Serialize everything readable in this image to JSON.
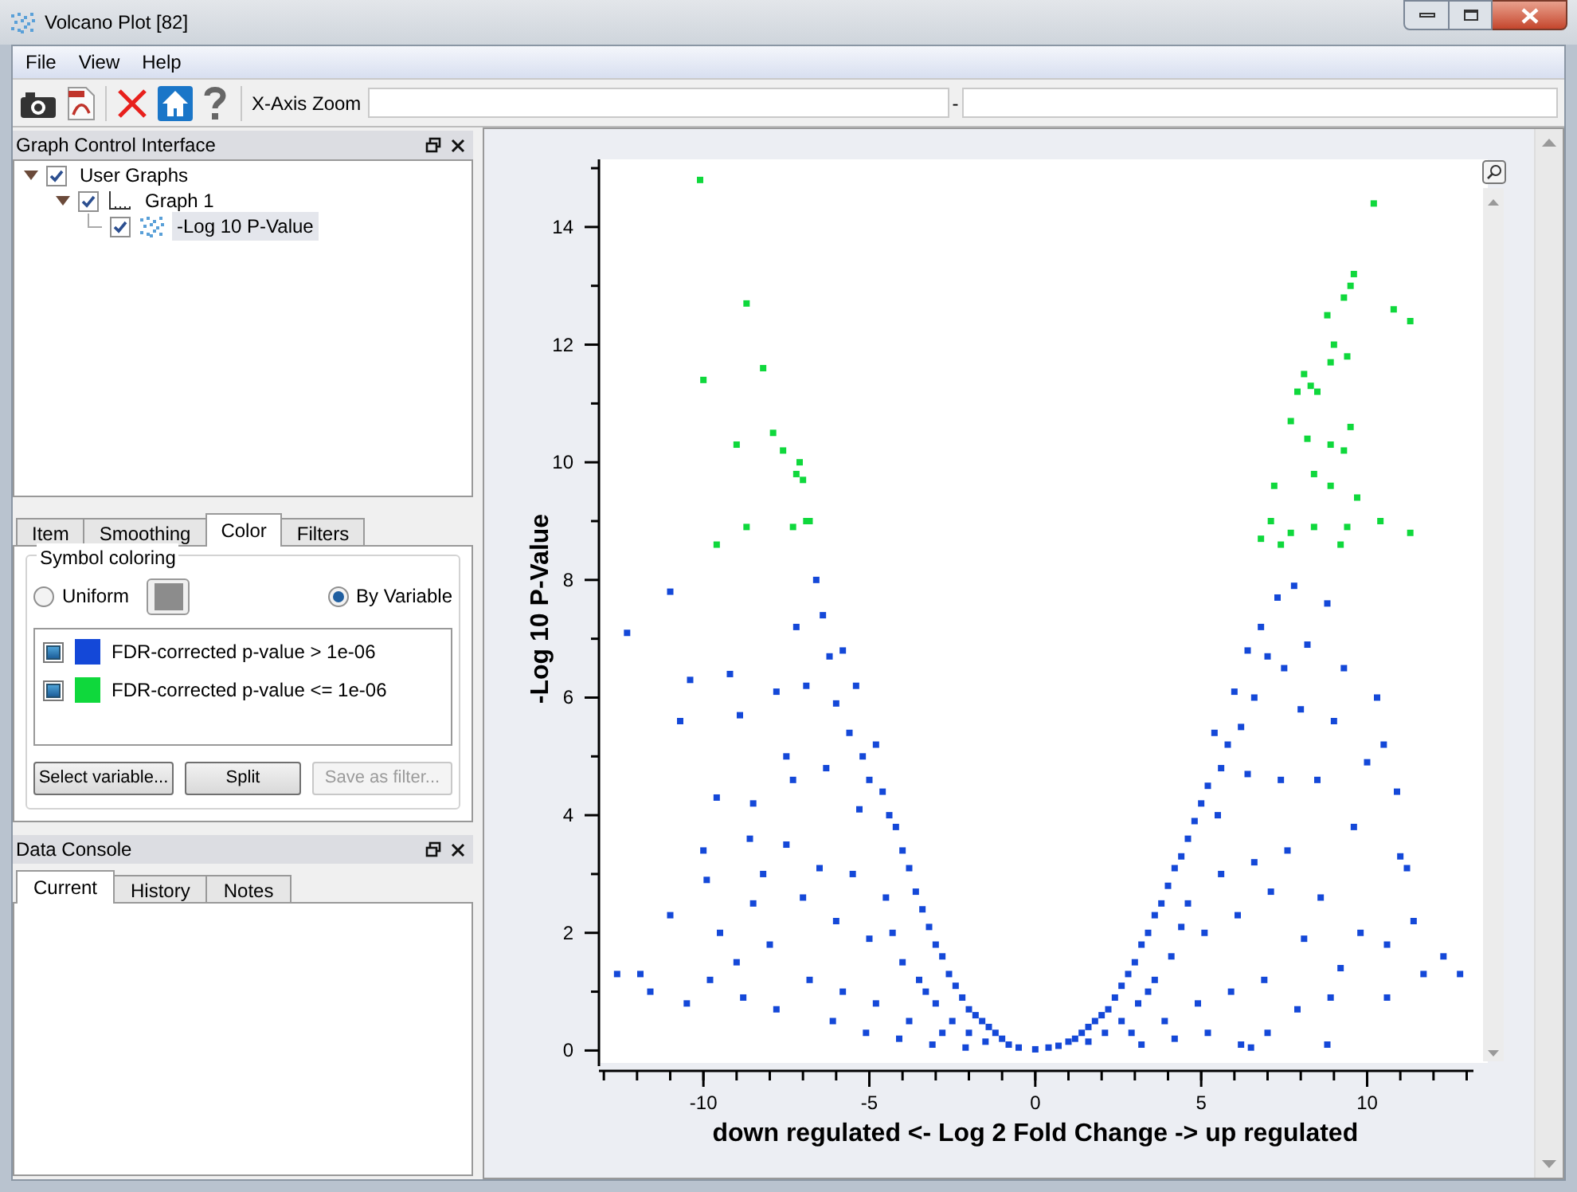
{
  "window": {
    "title": "Volcano Plot [82]"
  },
  "menu": [
    "File",
    "View",
    "Help"
  ],
  "toolbar": {
    "zoom_label": "X-Axis Zoom",
    "range_separator": "-"
  },
  "graph_control": {
    "title": "Graph Control Interface",
    "tree": [
      {
        "label": "User Graphs",
        "checked": true,
        "expanded": true,
        "children": [
          {
            "label": "Graph 1",
            "kind": "graph",
            "checked": true,
            "expanded": true,
            "children": [
              {
                "label": "-Log 10 P-Value",
                "kind": "series",
                "checked": true,
                "selected": true
              }
            ]
          }
        ]
      }
    ]
  },
  "tabs": [
    {
      "label": "Item",
      "selected": false
    },
    {
      "label": "Smoothing",
      "selected": false
    },
    {
      "label": "Color",
      "selected": true
    },
    {
      "label": "Filters",
      "selected": false
    }
  ],
  "symbol_coloring": {
    "title": "Symbol coloring",
    "options": [
      {
        "label": "Uniform",
        "selected": false
      },
      {
        "label": "By Variable",
        "selected": true
      }
    ],
    "categories": [
      {
        "label": "FDR-corrected p-value > 1e-06",
        "checked": true,
        "color": "#1448d8"
      },
      {
        "label": "FDR-corrected p-value <= 1e-06",
        "checked": true,
        "color": "#0fd83c"
      }
    ],
    "buttons": [
      {
        "label": "Select variable...",
        "disabled": false
      },
      {
        "label": "Split",
        "disabled": false
      },
      {
        "label": "Save as filter...",
        "disabled": true
      }
    ]
  },
  "data_console": {
    "title": "Data Console",
    "tabs": [
      {
        "label": "Current",
        "selected": true
      },
      {
        "label": "History",
        "selected": false
      },
      {
        "label": "Notes",
        "selected": false
      }
    ]
  },
  "chart": {
    "chart_data": {
      "type": "scatter",
      "xlabel": "down regulated <- Log 2 Fold Change -> up regulated",
      "ylabel": "-Log 10 P-Value",
      "xlim": [
        -13.1,
        13.3
      ],
      "ylim": [
        -0.13,
        15.15
      ],
      "xticks": [
        -10,
        -5,
        0,
        5,
        10
      ],
      "yticks": [
        0,
        2,
        4,
        6,
        8,
        10,
        12,
        14
      ],
      "series": [
        {
          "color": "#1448d8",
          "x": [
            -12.3,
            -11,
            -10.4,
            -10.7,
            -11.9,
            -12.6,
            -11.6,
            -11,
            -10,
            -9.6,
            -9.2,
            -8.9,
            -8.5,
            -8.2,
            -7.8,
            -7.5,
            -7.2,
            -6.9,
            -6.6,
            -6.4,
            -6.2,
            -6,
            -5.8,
            -5.6,
            -5.4,
            -5.2,
            -5,
            -4.8,
            -4.6,
            -4.4,
            -4.2,
            -4,
            -3.8,
            -3.6,
            -3.4,
            -3.2,
            -3,
            -2.8,
            -2.6,
            -2.4,
            -2.2,
            -2,
            -1.8,
            -1.6,
            -1.4,
            -1.2,
            -1,
            -0.8,
            -0.5,
            -9.5,
            -9,
            -8.5,
            -8,
            -7.5,
            -7,
            -6.5,
            -6,
            -5.5,
            -5,
            -4.5,
            -4,
            -3.5,
            -3,
            -2.5,
            -2,
            -1.5,
            -6.8,
            -5.8,
            -4.8,
            -3.8,
            -2.8,
            -8.8,
            -7.8,
            -10.5,
            -9.8,
            -7.3,
            -6.3,
            -5.3,
            -4.3,
            -3.3,
            -9.9,
            -8.6,
            -6.1,
            -5.1,
            -4.1,
            -3.1,
            -2.1,
            12.3,
            11.7,
            11.4,
            11,
            10.9,
            10.5,
            10.3,
            10,
            9.6,
            9.3,
            9,
            8.8,
            8.5,
            8.2,
            8,
            7.8,
            7.5,
            7.3,
            7,
            6.8,
            6.6,
            6.4,
            6.2,
            6,
            5.8,
            5.6,
            5.4,
            5.2,
            5,
            4.8,
            4.6,
            4.4,
            4.2,
            4,
            3.8,
            3.6,
            3.4,
            3.2,
            3,
            2.8,
            2.6,
            2.4,
            2.2,
            2,
            1.8,
            1.6,
            1.4,
            1.2,
            1,
            0.7,
            0.4,
            0,
            9.8,
            9.2,
            8.6,
            8.1,
            7.6,
            7.1,
            6.6,
            6.1,
            5.6,
            5.1,
            4.6,
            4.1,
            3.6,
            3.1,
            2.6,
            2.1,
            1.6,
            6.9,
            5.9,
            4.9,
            3.9,
            2.9,
            8.9,
            7.9,
            10.6,
            7.4,
            6.4,
            5.5,
            4.4,
            3.4,
            8.8,
            6.2,
            6.5,
            7,
            5.2,
            4.2,
            3.2,
            11.2,
            12.8,
            10.6
          ],
          "values": [
            7.1,
            7.8,
            6.3,
            5.6,
            1.3,
            1.3,
            1,
            2.3,
            3.4,
            4.3,
            6.4,
            5.7,
            4.2,
            3,
            6.1,
            5,
            7.2,
            6.2,
            8,
            7.4,
            6.7,
            5.9,
            6.8,
            5.4,
            6.2,
            5,
            4.6,
            5.2,
            4.4,
            4,
            3.8,
            3.4,
            3.1,
            2.7,
            2.4,
            2.1,
            1.8,
            1.6,
            1.3,
            1.1,
            0.9,
            0.7,
            0.6,
            0.5,
            0.4,
            0.3,
            0.2,
            0.1,
            0.05,
            2,
            1.5,
            2.5,
            1.8,
            3.5,
            2.6,
            3.1,
            2.2,
            3,
            1.9,
            2.6,
            1.5,
            1.2,
            0.8,
            0.5,
            0.3,
            0.15,
            1.2,
            1,
            0.8,
            0.5,
            0.3,
            0.9,
            0.7,
            0.8,
            1.2,
            4.6,
            4.8,
            4.1,
            2,
            1,
            2.9,
            3.6,
            0.5,
            0.3,
            0.2,
            0.1,
            0.05,
            1.6,
            1.3,
            2.2,
            3.3,
            4.4,
            5.2,
            6,
            4.9,
            3.8,
            6.5,
            5.6,
            7.6,
            4.6,
            6.9,
            5.8,
            7.9,
            6.5,
            7.7,
            6.7,
            7.2,
            6,
            6.8,
            5.5,
            6.1,
            5.2,
            4.8,
            5.4,
            4.5,
            4.2,
            3.9,
            3.6,
            3.3,
            3.1,
            2.8,
            2.5,
            2.3,
            2,
            1.8,
            1.5,
            1.3,
            1.1,
            0.9,
            0.7,
            0.6,
            0.5,
            0.4,
            0.3,
            0.2,
            0.15,
            0.08,
            0.05,
            0.02,
            2,
            1.4,
            2.6,
            1.9,
            3.4,
            2.7,
            3.2,
            2.3,
            3,
            2,
            2.5,
            1.6,
            1.2,
            0.8,
            0.5,
            0.3,
            0.15,
            1.2,
            1,
            0.8,
            0.5,
            0.3,
            0.9,
            0.7,
            0.9,
            4.6,
            4.7,
            4,
            2.1,
            1,
            0.1,
            0.1,
            0.05,
            0.3,
            0.3,
            0.2,
            0.1,
            3.1,
            1.3,
            1.8
          ]
        },
        {
          "color": "#0fd83c",
          "x": [
            -10.1,
            -10,
            -9.6,
            -9,
            -8.7,
            -8.7,
            -8.2,
            -7.9,
            -7.6,
            -7.2,
            -7.1,
            -7,
            -7.3,
            -6.9,
            -6.8,
            10.2,
            9.6,
            9.5,
            9.3,
            8.8,
            9,
            8.9,
            9.4,
            8.5,
            8.3,
            7.9,
            8.1,
            7.7,
            8.2,
            8.9,
            9.5,
            9.3,
            10.8,
            11.3,
            8.4,
            7.2,
            8.9,
            9.7,
            7.7,
            8.4,
            9.2,
            10.4,
            11.3,
            7.1,
            6.8,
            7.4,
            9.4
          ],
          "values": [
            14.8,
            11.4,
            8.6,
            10.3,
            12.7,
            8.9,
            11.6,
            10.5,
            10.2,
            9.8,
            10,
            9.7,
            8.9,
            9,
            9,
            14.4,
            13.2,
            13,
            12.8,
            12.5,
            12,
            11.7,
            11.8,
            11.2,
            11.3,
            11.2,
            11.5,
            10.7,
            10.4,
            10.3,
            10.6,
            10.2,
            12.6,
            12.4,
            9.8,
            9.6,
            9.6,
            9.4,
            8.8,
            8.9,
            8.6,
            9,
            8.8,
            9,
            8.7,
            8.6,
            8.9
          ]
        }
      ]
    }
  }
}
